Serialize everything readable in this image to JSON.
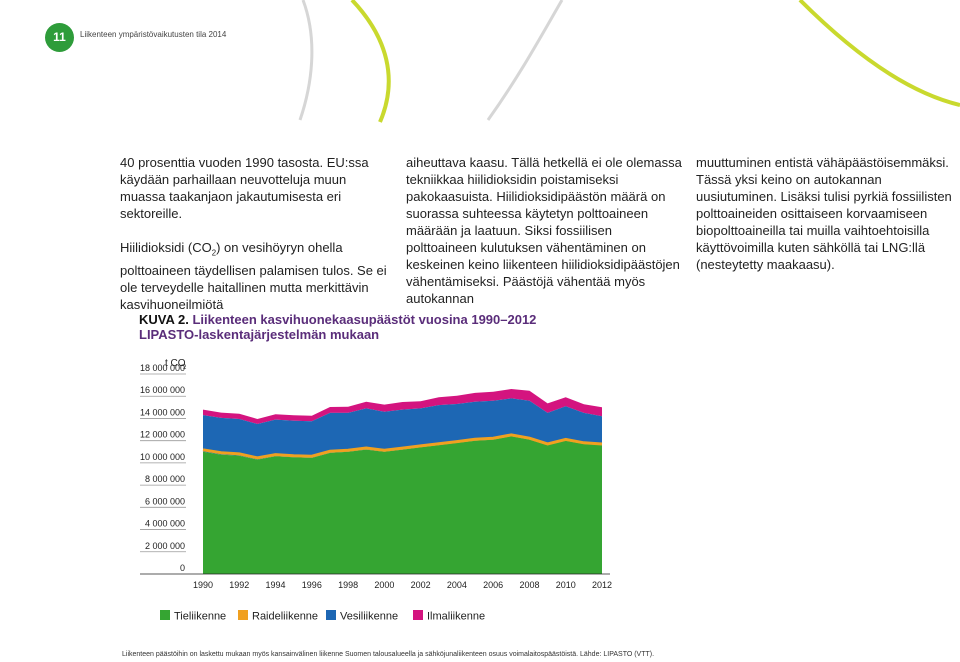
{
  "header": {
    "page_number": "11",
    "running_title": "Liikenteen ympäristövaikutusten tila 2014"
  },
  "body_text": {
    "col1_p1": "40 prosenttia vuoden 1990 tasosta. EU:ssa käydään parhaillaan neuvotteluja muun muassa taakanjaon jakautumisesta eri sektoreille.",
    "col1_p2_a": "Hiilidioksidi (CO",
    "col1_p2_sub": "2",
    "col1_p2_b": ") on vesihöyryn ohella polttoaineen täydellisen palamisen tulos. Se ei ole terveydelle haitallinen mutta merkittävin kasvihuoneilmiötä",
    "col2": "aiheuttava kaasu. Tällä hetkellä ei ole olemassa tekniikkaa hiilidioksidin poistamiseksi pakokaasuista. Hiilidioksidipäästön määrä on suorassa suhteessa käytetyn polttoaineen määrään ja laatuun. Siksi fossiilisen polttoaineen kulutuksen vähentäminen on keskeinen keino liikenteen hiilidioksidipäästöjen vähentämiseksi. Päästöjä vähentää myös autokannan",
    "col3": "muuttuminen entistä vähäpäästöisemmäksi. Tässä yksi keino on autokannan uusiutuminen. Lisäksi tulisi pyrkiä fossiilisten polttoaineiden osittaiseen korvaamiseen biopolttoaineilla tai muilla vaihtoehtoisilla käyttövoimilla kuten sähköllä tai LNG:llä (nesteytetty maakaasu)."
  },
  "figure": {
    "label": "KUVA 2.",
    "title_line1": "Liikenteen kasvihuonekaasupäästöt vuosina 1990–2012",
    "title_line2": "LIPASTO-laskentajärjestelmän mukaan"
  },
  "chart_data": {
    "type": "area",
    "stacked": true,
    "unit_label": "t CO",
    "unit_sub": "2",
    "x": [
      1990,
      1991,
      1992,
      1993,
      1994,
      1995,
      1996,
      1997,
      1998,
      1999,
      2000,
      2001,
      2002,
      2003,
      2004,
      2005,
      2006,
      2007,
      2008,
      2009,
      2010,
      2011,
      2012
    ],
    "x_tick_labels": [
      "1990",
      "1992",
      "1994",
      "1996",
      "1998",
      "2000",
      "2002",
      "2004",
      "2006",
      "2008",
      "2010",
      "2012"
    ],
    "y_tick_labels": [
      "0",
      "2 000 000",
      "4 000 000",
      "6 000 000",
      "8 000 000",
      "10 000 000",
      "12 000 000",
      "14 000 000",
      "16 000 000",
      "18 000 000"
    ],
    "ylim": [
      0,
      18000000
    ],
    "series": [
      {
        "name": "Tieliikenne",
        "color": "#35a532",
        "values": [
          11000000,
          10750000,
          10650000,
          10300000,
          10600000,
          10500000,
          10450000,
          10900000,
          11000000,
          11200000,
          11000000,
          11200000,
          11400000,
          11600000,
          11800000,
          12000000,
          12100000,
          12400000,
          12100000,
          11600000,
          12000000,
          11700000,
          11600000
        ]
      },
      {
        "name": "Raideliikenne",
        "color": "#f0a020",
        "values": [
          180000,
          170000,
          160000,
          150000,
          150000,
          150000,
          150000,
          140000,
          140000,
          140000,
          130000,
          130000,
          130000,
          120000,
          120000,
          120000,
          120000,
          120000,
          120000,
          110000,
          110000,
          110000,
          100000
        ]
      },
      {
        "name": "Vesiliikenne",
        "color": "#1d67b4",
        "values": [
          3300000,
          3300000,
          3300000,
          3200000,
          3300000,
          3300000,
          3300000,
          3600000,
          3500000,
          3700000,
          3600000,
          3600000,
          3500000,
          3600000,
          3500000,
          3500000,
          3500000,
          3400000,
          3500000,
          2900000,
          3100000,
          2800000,
          2600000
        ]
      },
      {
        "name": "Ilmaliikenne",
        "color": "#d4147f",
        "values": [
          500000,
          480000,
          470000,
          450000,
          470000,
          480000,
          500000,
          530000,
          550000,
          600000,
          650000,
          680000,
          650000,
          700000,
          750000,
          800000,
          800000,
          850000,
          900000,
          850000,
          800000,
          780000,
          800000
        ]
      }
    ]
  },
  "footnote": "Liikenteen päästöihin on laskettu mukaan myös kansainvälinen liikenne Suomen talousalueella ja sähköjunaliikenteen osuus voimalaitospäästöistä. Lähde: LIPASTO (VTT)."
}
